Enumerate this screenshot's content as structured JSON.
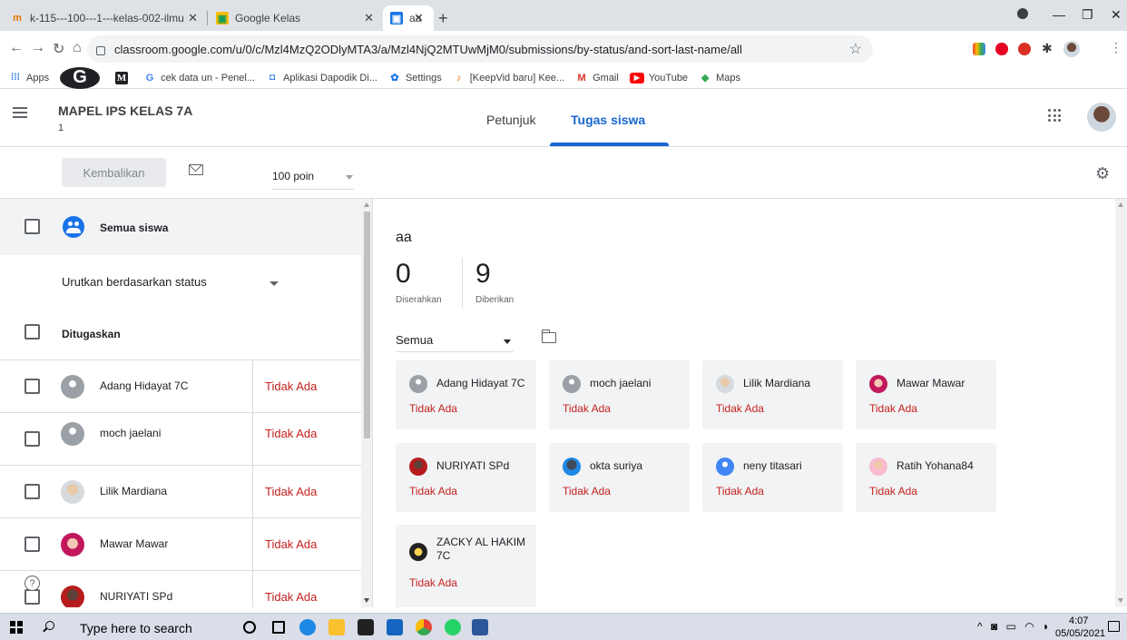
{
  "browser": {
    "tabs": [
      {
        "title": "k-115---100---1---kelas-002-ilmu",
        "active": false
      },
      {
        "title": "Google Kelas",
        "active": false
      },
      {
        "title": "aa",
        "active": true
      }
    ],
    "url": "classroom.google.com/u/0/c/Mzl4MzQ2ODlyMTA3/a/Mzl4NjQ2MTUwMjM0/submissions/by-status/and-sort-last-name/all",
    "bookmarks": [
      {
        "label": "Apps",
        "icon": "apps-grid-icon"
      },
      {
        "label": "",
        "icon": "g-logo-icon"
      },
      {
        "label": "",
        "icon": "m-logo-icon"
      },
      {
        "label": "cek data un - Penel...",
        "icon": "google-icon"
      },
      {
        "label": "Aplikasi Dapodik Di...",
        "icon": "dapodik-icon"
      },
      {
        "label": "Settings",
        "icon": "gear-icon"
      },
      {
        "label": "[KeepVid baru] Kee...",
        "icon": "keepvid-icon"
      },
      {
        "label": "Gmail",
        "icon": "gmail-icon"
      },
      {
        "label": "YouTube",
        "icon": "youtube-icon"
      },
      {
        "label": "Maps",
        "icon": "maps-icon"
      }
    ]
  },
  "header": {
    "class_title": "MAPEL IPS KELAS 7A",
    "class_section": "1",
    "tabs": [
      "Petunjuk",
      "Tugas siswa"
    ],
    "active_tab": "Tugas siswa"
  },
  "toolbar": {
    "return_label": "Kembalikan",
    "points": "100 poin"
  },
  "list": {
    "all_students": "Semua siswa",
    "sort_label": "Urutkan berdasarkan status",
    "group_label": "Ditugaskan",
    "students": [
      {
        "name": "Adang Hidayat 7C",
        "status": "Tidak Ada"
      },
      {
        "name": "moch jaelani",
        "status": "Tidak Ada"
      },
      {
        "name": "Lilik Mardiana",
        "status": "Tidak Ada"
      },
      {
        "name": "Mawar Mawar",
        "status": "Tidak Ada"
      },
      {
        "name": "NURIYATI SPd",
        "status": "Tidak Ada"
      }
    ]
  },
  "detail": {
    "title": "aa",
    "turned_in_count": "0",
    "turned_in_label": "Diserahkan",
    "assigned_count": "9",
    "assigned_label": "Diberikan",
    "filter": "Semua",
    "cards": [
      {
        "name": "Adang Hidayat 7C",
        "status": "Tidak Ada"
      },
      {
        "name": "moch jaelani",
        "status": "Tidak Ada"
      },
      {
        "name": "Lilik Mardiana",
        "status": "Tidak Ada"
      },
      {
        "name": "Mawar Mawar",
        "status": "Tidak Ada"
      },
      {
        "name": "NURIYATI SPd",
        "status": "Tidak Ada"
      },
      {
        "name": "okta suriya",
        "status": "Tidak Ada"
      },
      {
        "name": "neny titasari",
        "status": "Tidak Ada"
      },
      {
        "name": "Ratih Yohana84",
        "status": "Tidak Ada"
      },
      {
        "name": "ZACKY AL HAKIM 7C",
        "status": "Tidak Ada"
      }
    ]
  },
  "taskbar": {
    "search_placeholder": "Type here to search",
    "time": "4:07",
    "date": "05/05/2021"
  },
  "colors": {
    "accent": "#1967d2",
    "missing": "#c5221f",
    "card_bg": "#f1f3f4"
  }
}
